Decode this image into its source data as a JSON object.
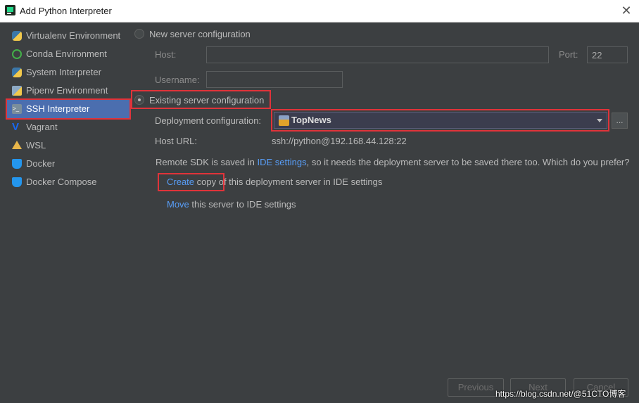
{
  "window": {
    "title": "Add Python Interpreter",
    "close_icon": "close-icon"
  },
  "sidebar": {
    "items": [
      {
        "label": "Virtualenv Environment",
        "icon": "python-icon",
        "selected": false
      },
      {
        "label": "Conda Environment",
        "icon": "conda-icon",
        "selected": false
      },
      {
        "label": "System Interpreter",
        "icon": "python-icon",
        "selected": false
      },
      {
        "label": "Pipenv Environment",
        "icon": "pipenv-icon",
        "selected": false
      },
      {
        "label": "SSH Interpreter",
        "icon": "ssh-terminal-icon",
        "selected": true
      },
      {
        "label": "Vagrant",
        "icon": "vagrant-icon",
        "selected": false
      },
      {
        "label": "WSL",
        "icon": "wsl-icon",
        "selected": false
      },
      {
        "label": "Docker",
        "icon": "docker-icon",
        "selected": false
      },
      {
        "label": "Docker Compose",
        "icon": "docker-compose-icon",
        "selected": false
      }
    ]
  },
  "new_server": {
    "radio_label": "New server configuration",
    "checked": false,
    "host_label": "Host:",
    "host_value": "",
    "port_label": "Port:",
    "port_value": "22",
    "username_label": "Username:",
    "username_value": ""
  },
  "existing_server": {
    "radio_label": "Existing server configuration",
    "checked": true,
    "deployment_label": "Deployment configuration:",
    "deployment_value": "TopNews",
    "more_button": "...",
    "host_url_label": "Host URL:",
    "host_url_value": "ssh://python@192.168.44.128:22"
  },
  "notice": {
    "prefix": "Remote SDK is saved in ",
    "link": "IDE settings",
    "suffix": ", so it needs the deployment server to be saved there too. Which do you prefer?"
  },
  "options": {
    "create_link": "Create",
    "create_text": "copy of this deployment server in IDE settings",
    "move_link": "Move",
    "move_text": "this server to IDE settings"
  },
  "footer": {
    "previous": "Previous",
    "next": "Next",
    "cancel": "Cancel"
  },
  "watermark": "https://blog.csdn.net/@51CTO博客"
}
